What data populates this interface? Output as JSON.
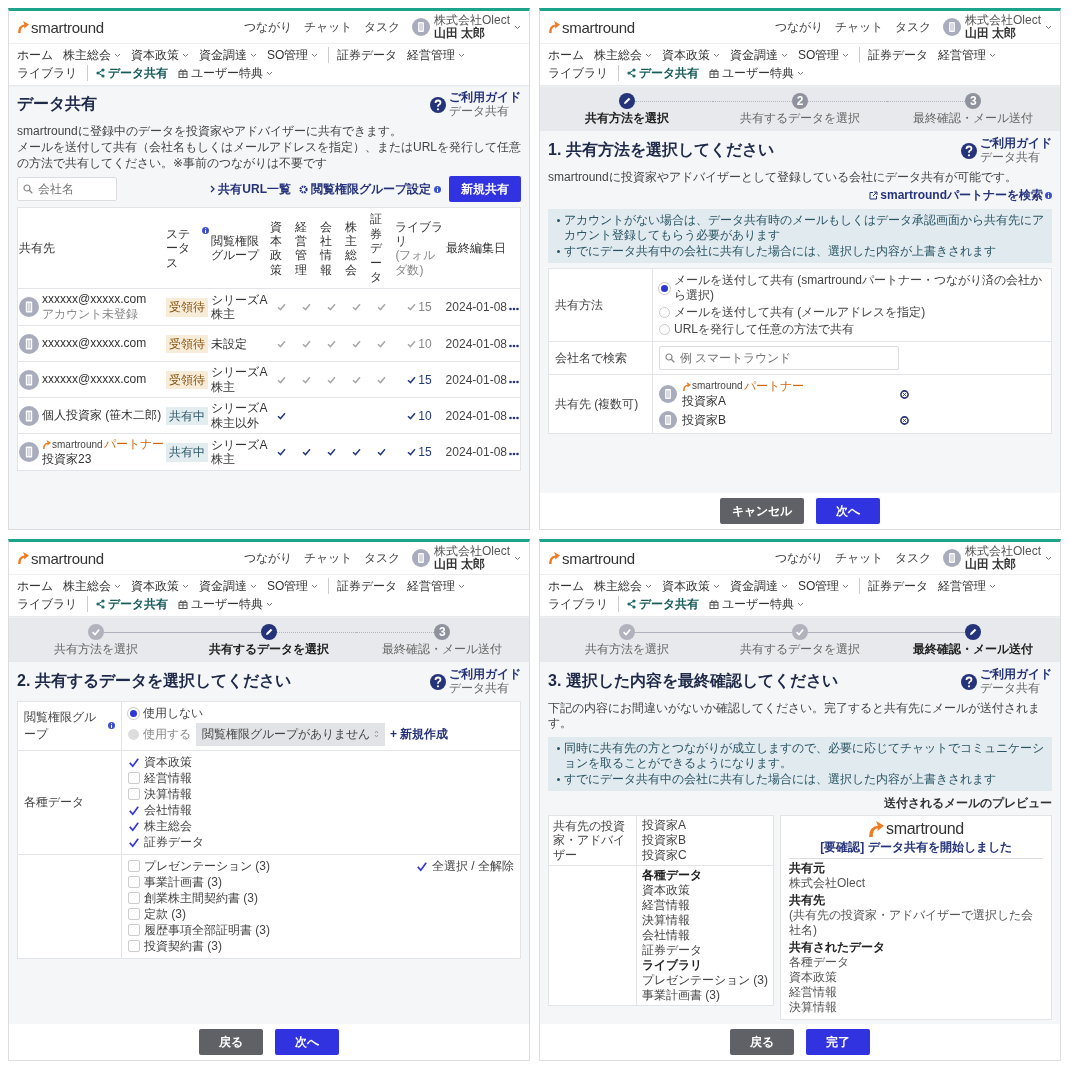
{
  "screens": [
    {
      "kind": "list",
      "header": {
        "logo": "smartround",
        "links": [
          "つながり",
          "チャット",
          "タスク"
        ],
        "company": "株式会社Olect",
        "user": "山田 太郎"
      },
      "nav": [
        {
          "label": "ホーム",
          "kind": "plain",
          "dropdown": false,
          "divider_before": false,
          "selected": false
        },
        {
          "label": "株主総会",
          "kind": "plain",
          "dropdown": true,
          "divider_before": false,
          "selected": false
        },
        {
          "label": "資本政策",
          "kind": "plain",
          "dropdown": true,
          "divider_before": false,
          "selected": false
        },
        {
          "label": "資金調達",
          "kind": "plain",
          "dropdown": true,
          "divider_before": false,
          "selected": false
        },
        {
          "label": "SO管理",
          "kind": "plain",
          "dropdown": true,
          "divider_before": false,
          "selected": false
        },
        {
          "label": "証券データ",
          "kind": "plain",
          "dropdown": false,
          "divider_before": true,
          "selected": false
        },
        {
          "label": "経営管理",
          "kind": "plain",
          "dropdown": true,
          "divider_before": false,
          "selected": false
        },
        {
          "label": "ライブラリ",
          "kind": "plain",
          "dropdown": false,
          "divider_before": false,
          "selected": false
        },
        {
          "label": "データ共有",
          "kind": "share",
          "dropdown": false,
          "divider_before": true,
          "selected": true
        },
        {
          "label": "ユーザー特典",
          "kind": "gift",
          "dropdown": true,
          "divider_before": false,
          "selected": false
        }
      ],
      "title": "データ共有",
      "guide": {
        "label": "ご利用ガイド",
        "sub": "データ共有"
      },
      "description": [
        "smartroundに登録中のデータを投資家やアドバイザーに共有できます。",
        "メールを送付して共有（会社名もしくはメールアドレスを指定）、またはURLを発行して任意の方法で共有してください。※事前のつながりは不要です"
      ],
      "search": {
        "placeholder": "会社名"
      },
      "links": [
        {
          "label": "共有URL一覧",
          "kind": "chevron",
          "info": false
        },
        {
          "label": "閲覧権限グループ設定",
          "kind": "gear",
          "info": true
        }
      ],
      "primary_button": "新規共有",
      "table": {
        "columns": [
          {
            "label": "共有先",
            "info": false
          },
          {
            "label": "ステータス",
            "info": true
          },
          {
            "label": "閲覧権限グループ",
            "info": false
          },
          {
            "label": "資本政策",
            "info": false
          },
          {
            "label": "経営管理",
            "info": false
          },
          {
            "label": "会社情報",
            "info": false
          },
          {
            "label": "株主総会",
            "info": false
          },
          {
            "label": "証券データ",
            "info": false
          },
          {
            "label": "ライブラリ",
            "sub": "(フォルダ数)",
            "info": false
          },
          {
            "label": "最終編集日",
            "info": false
          }
        ],
        "rows": [
          {
            "name": "xxxxxx@xxxxx.com",
            "note": "アカウント未登録",
            "status": {
              "label": "受領待",
              "kind": "pending"
            },
            "group": "シリーズA株主",
            "checks": [
              {
                "checked": true,
                "dimmed": true
              },
              {
                "checked": true,
                "dimmed": true
              },
              {
                "checked": true,
                "dimmed": true
              },
              {
                "checked": true,
                "dimmed": true
              },
              {
                "checked": true,
                "dimmed": true
              }
            ],
            "library": {
              "checked": true,
              "dimmed": true,
              "count": "15"
            },
            "date": "2024-01-08"
          },
          {
            "name": "xxxxxx@xxxxx.com",
            "status": {
              "label": "受領待",
              "kind": "pending"
            },
            "group": "未設定",
            "checks": [
              {
                "checked": true,
                "dimmed": true
              },
              {
                "checked": true,
                "dimmed": true
              },
              {
                "checked": true,
                "dimmed": true
              },
              {
                "checked": true,
                "dimmed": true
              },
              {
                "checked": true,
                "dimmed": true
              }
            ],
            "library": {
              "checked": true,
              "dimmed": true,
              "count": "10"
            },
            "date": "2024-01-08"
          },
          {
            "name": "xxxxxx@xxxxx.com",
            "status": {
              "label": "受領待",
              "kind": "pending"
            },
            "group": "シリーズA株主",
            "checks": [
              {
                "checked": true,
                "dimmed": true
              },
              {
                "checked": true,
                "dimmed": true
              },
              {
                "checked": true,
                "dimmed": true
              },
              {
                "checked": true,
                "dimmed": true
              },
              {
                "checked": true,
                "dimmed": true
              }
            ],
            "library": {
              "checked": true,
              "dimmed": false,
              "count": "15"
            },
            "date": "2024-01-08"
          },
          {
            "name": "個人投資家 (笹木二郎)",
            "status": {
              "label": "共有中",
              "kind": "sharing"
            },
            "group": "シリーズA株主以外",
            "checks": [
              {
                "checked": true,
                "dimmed": false
              },
              {
                "checked": false
              },
              {
                "checked": false
              },
              {
                "checked": false
              },
              {
                "checked": false
              }
            ],
            "library": {
              "checked": true,
              "dimmed": false,
              "count": "10"
            },
            "date": "2024-01-08"
          },
          {
            "partner": {
              "logo": "smartround",
              "label": "パートナー"
            },
            "name": "投資家23",
            "status": {
              "label": "共有中",
              "kind": "sharing"
            },
            "group": "シリーズA株主",
            "checks": [
              {
                "checked": true,
                "dimmed": false
              },
              {
                "checked": true,
                "dimmed": false
              },
              {
                "checked": true,
                "dimmed": false
              },
              {
                "checked": true,
                "dimmed": false
              },
              {
                "checked": true,
                "dimmed": false
              }
            ],
            "library": {
              "checked": true,
              "dimmed": false,
              "count": "15"
            },
            "date": "2024-01-08"
          }
        ]
      }
    },
    {
      "kind": "method",
      "header": {
        "logo": "smartround",
        "links": [
          "つながり",
          "チャット",
          "タスク"
        ],
        "company": "株式会社Olect",
        "user": "山田 太郎"
      },
      "nav": [
        {
          "label": "ホーム",
          "kind": "plain",
          "dropdown": false,
          "divider_before": false,
          "selected": false
        },
        {
          "label": "株主総会",
          "kind": "plain",
          "dropdown": true,
          "divider_before": false,
          "selected": false
        },
        {
          "label": "資本政策",
          "kind": "plain",
          "dropdown": true,
          "divider_before": false,
          "selected": false
        },
        {
          "label": "資金調達",
          "kind": "plain",
          "dropdown": true,
          "divider_before": false,
          "selected": false
        },
        {
          "label": "SO管理",
          "kind": "plain",
          "dropdown": true,
          "divider_before": false,
          "selected": false
        },
        {
          "label": "証券データ",
          "kind": "plain",
          "dropdown": false,
          "divider_before": true,
          "selected": false
        },
        {
          "label": "経営管理",
          "kind": "plain",
          "dropdown": true,
          "divider_before": false,
          "selected": false
        },
        {
          "label": "ライブラリ",
          "kind": "plain",
          "dropdown": false,
          "divider_before": false,
          "selected": false
        },
        {
          "label": "データ共有",
          "kind": "share",
          "dropdown": false,
          "divider_before": true,
          "selected": true
        },
        {
          "label": "ユーザー特典",
          "kind": "gift",
          "dropdown": true,
          "divider_before": false,
          "selected": false
        }
      ],
      "steps": [
        {
          "label": "共有方法を選択",
          "done": false,
          "current": true
        },
        {
          "label": "共有するデータを選択",
          "done": false,
          "current": false,
          "number": "2"
        },
        {
          "label": "最終確認・メール送付",
          "done": false,
          "current": false,
          "number": "3"
        }
      ],
      "title": "1. 共有方法を選択してください",
      "guide": {
        "label": "ご利用ガイド",
        "sub": "データ共有"
      },
      "description": "smartroundに投資家やアドバイザーとして登録している会社にデータ共有が可能です。",
      "partner_link": {
        "label": "smartroundパートナーを検索",
        "info": true
      },
      "notices": [
        "アカウントがない場合は、データ共有時のメールもしくはデータ承認画面から共有先にアカウント登録してもらう必要があります",
        "すでにデータ共有中の会社に共有した場合には、選択した内容が上書きされます"
      ],
      "form": [
        {
          "kind": "radio",
          "label": "共有方法",
          "options": [
            {
              "label": "メールを送付して共有 (smartroundパートナー・つながり済の会社から選択)",
              "selected": true,
              "disabled": false
            },
            {
              "label": "メールを送付して共有 (メールアドレスを指定)",
              "selected": false,
              "disabled": false
            },
            {
              "label": "URLを発行して任意の方法で共有",
              "selected": false,
              "disabled": false
            }
          ]
        },
        {
          "kind": "search",
          "label": "会社名で検索",
          "placeholder": "例 スマートラウンド"
        },
        {
          "kind": "recipients",
          "label": "共有先 (複数可)",
          "items": [
            {
              "partner": {
                "logo": "smartround",
                "label": "パートナー"
              },
              "name": "投資家A"
            },
            {
              "name": "投資家B"
            }
          ]
        }
      ],
      "buttons": [
        {
          "label": "キャンセル",
          "kind": "cancel"
        },
        {
          "label": "次へ",
          "kind": "next"
        }
      ]
    },
    {
      "kind": "data",
      "header": {
        "logo": "smartround",
        "links": [
          "つながり",
          "チャット",
          "タスク"
        ],
        "company": "株式会社Olect",
        "user": "山田 太郎"
      },
      "nav": [
        {
          "label": "ホーム",
          "kind": "plain",
          "dropdown": false,
          "divider_before": false,
          "selected": false
        },
        {
          "label": "株主総会",
          "kind": "plain",
          "dropdown": true,
          "divider_before": false,
          "selected": false
        },
        {
          "label": "資本政策",
          "kind": "plain",
          "dropdown": true,
          "divider_before": false,
          "selected": false
        },
        {
          "label": "資金調達",
          "kind": "plain",
          "dropdown": true,
          "divider_before": false,
          "selected": false
        },
        {
          "label": "SO管理",
          "kind": "plain",
          "dropdown": true,
          "divider_before": false,
          "selected": false
        },
        {
          "label": "証券データ",
          "kind": "plain",
          "dropdown": false,
          "divider_before": true,
          "selected": false
        },
        {
          "label": "経営管理",
          "kind": "plain",
          "dropdown": true,
          "divider_before": false,
          "selected": false
        },
        {
          "label": "ライブラリ",
          "kind": "plain",
          "dropdown": false,
          "divider_before": false,
          "selected": false
        },
        {
          "label": "データ共有",
          "kind": "share",
          "dropdown": false,
          "divider_before": true,
          "selected": true
        },
        {
          "label": "ユーザー特典",
          "kind": "gift",
          "dropdown": true,
          "divider_before": false,
          "selected": false
        }
      ],
      "steps": [
        {
          "label": "共有方法を選択",
          "done": true,
          "current": false
        },
        {
          "label": "共有するデータを選択",
          "done": false,
          "current": true
        },
        {
          "label": "最終確認・メール送付",
          "done": false,
          "current": false,
          "number": "3"
        }
      ],
      "title": "2. 共有するデータを選択してください",
      "guide": {
        "label": "ご利用ガイド",
        "sub": "データ共有"
      },
      "form": [
        {
          "kind": "group",
          "label": "閲覧権限グループ",
          "info": true,
          "options": [
            {
              "label": "使用しない",
              "selected": true,
              "disabled": false
            },
            {
              "label": "使用する",
              "selected": false,
              "disabled": true
            }
          ],
          "select": {
            "value": "閲覧権限グループがありません",
            "disabled": true
          },
          "create_link": "+ 新規作成"
        },
        {
          "kind": "checks",
          "label": "各種データ",
          "items": [
            {
              "label": "資本政策",
              "checked": true
            },
            {
              "label": "経営情報",
              "checked": false
            },
            {
              "label": "決算情報",
              "checked": false
            },
            {
              "label": "会社情報",
              "checked": true
            },
            {
              "label": "株主総会",
              "checked": true
            },
            {
              "label": "証券データ",
              "checked": true
            }
          ]
        },
        {
          "kind": "checks",
          "items": [
            {
              "label": "プレゼンテーション (3)",
              "checked": false
            },
            {
              "label": "事業計画書 (3)",
              "checked": false
            },
            {
              "label": "創業株主間契約書 (3)",
              "checked": false
            },
            {
              "label": "定款 (3)",
              "checked": false
            },
            {
              "label": "履歴事項全部証明書 (3)",
              "checked": false
            },
            {
              "label": "投資契約書 (3)",
              "checked": false
            }
          ],
          "toggle_all": {
            "label": "全選択 / 全解除",
            "checked": true
          }
        }
      ],
      "buttons": [
        {
          "label": "戻る",
          "kind": "back"
        },
        {
          "label": "次へ",
          "kind": "next"
        }
      ]
    },
    {
      "kind": "confirm",
      "header": {
        "logo": "smartround",
        "links": [
          "つながり",
          "チャット",
          "タスク"
        ],
        "company": "株式会社Olect",
        "user": "山田 太郎"
      },
      "nav": [
        {
          "label": "ホーム",
          "kind": "plain",
          "dropdown": false,
          "divider_before": false,
          "selected": false
        },
        {
          "label": "株主総会",
          "kind": "plain",
          "dropdown": true,
          "divider_before": false,
          "selected": false
        },
        {
          "label": "資本政策",
          "kind": "plain",
          "dropdown": true,
          "divider_before": false,
          "selected": false
        },
        {
          "label": "資金調達",
          "kind": "plain",
          "dropdown": true,
          "divider_before": false,
          "selected": false
        },
        {
          "label": "SO管理",
          "kind": "plain",
          "dropdown": true,
          "divider_before": false,
          "selected": false
        },
        {
          "label": "証券データ",
          "kind": "plain",
          "dropdown": false,
          "divider_before": true,
          "selected": false
        },
        {
          "label": "経営管理",
          "kind": "plain",
          "dropdown": true,
          "divider_before": false,
          "selected": false
        },
        {
          "label": "ライブラリ",
          "kind": "plain",
          "dropdown": false,
          "divider_before": false,
          "selected": false
        },
        {
          "label": "データ共有",
          "kind": "share",
          "dropdown": false,
          "divider_before": true,
          "selected": true
        },
        {
          "label": "ユーザー特典",
          "kind": "gift",
          "dropdown": true,
          "divider_before": false,
          "selected": false
        }
      ],
      "steps": [
        {
          "label": "共有方法を選択",
          "done": true,
          "current": false
        },
        {
          "label": "共有するデータを選択",
          "done": true,
          "current": false
        },
        {
          "label": "最終確認・メール送付",
          "done": false,
          "current": true
        }
      ],
      "title": "3. 選択した内容を最終確認してください",
      "guide": {
        "label": "ご利用ガイド",
        "sub": "データ共有"
      },
      "description": "下記の内容にお間違いがないか確認してください。完了すると共有先にメールが送付されます。",
      "notices": [
        "同時に共有先の方とつながりが成立しますので、必要に応じてチャットでコミュニケーションを取ることができるようになります。",
        "すでにデータ共有中の会社に共有した場合には、選択した内容が上書きされます"
      ],
      "preview_label": "送付されるメールのプレビュー",
      "summary": [
        {
          "label": "共有先の投資家・アドバイザー",
          "items": [
            {
              "text": "投資家A",
              "heading": false
            },
            {
              "text": "投資家B",
              "heading": false
            },
            {
              "text": "投資家C",
              "heading": false
            }
          ]
        },
        {
          "items": [
            {
              "text": "各種データ",
              "heading": true
            },
            {
              "text": "資本政策",
              "heading": false
            },
            {
              "text": "経営情報",
              "heading": false
            },
            {
              "text": "決算情報",
              "heading": false
            },
            {
              "text": "会社情報",
              "heading": false
            },
            {
              "text": "証券データ",
              "heading": false
            },
            {
              "text": "ライブラリ",
              "heading": true
            },
            {
              "text": "プレゼンテーション (3)",
              "heading": false
            },
            {
              "text": "事業計画書 (3)",
              "heading": false
            }
          ]
        }
      ],
      "preview": {
        "logo": "smartround",
        "title": "[要確認] データ共有を開始しました",
        "fields": [
          {
            "label": "共有元",
            "lines": [
              "株式会社Olect"
            ]
          },
          {
            "label": "共有先",
            "lines": [
              "(共有先の投資家・アドバイザーで選択した会社名)"
            ]
          },
          {
            "label": "共有されたデータ",
            "lines": [
              "各種データ",
              "資本政策",
              "経営情報",
              "決算情報"
            ]
          }
        ]
      },
      "buttons": [
        {
          "label": "戻る",
          "kind": "back"
        },
        {
          "label": "完了",
          "kind": "finish"
        }
      ]
    }
  ]
}
